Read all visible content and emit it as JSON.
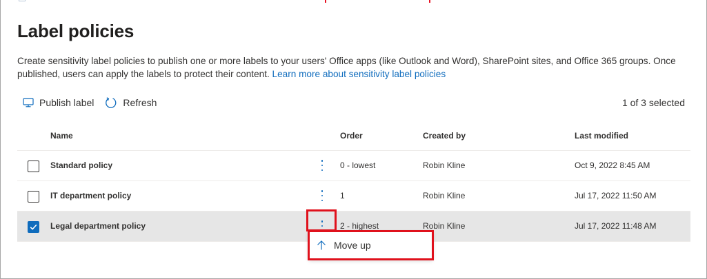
{
  "page": {
    "title": "Label policies",
    "description": "Create sensitivity label policies to publish one or more labels to your users' Office apps (like Outlook and Word), SharePoint sites, and Office 365 groups. Once published, users can apply the labels to protect their content.",
    "learn_more_link": "Learn more about sensitivity label policies"
  },
  "toolbar": {
    "publish_label": "Publish label",
    "publish_icon": "monitor-icon",
    "refresh_label": "Refresh",
    "refresh_icon": "refresh-icon",
    "selection_count": "1 of 3 selected"
  },
  "table": {
    "columns": {
      "name": "Name",
      "order": "Order",
      "created_by": "Created by",
      "last_modified": "Last modified"
    },
    "rows": [
      {
        "name": "Standard policy",
        "order": "0 - lowest",
        "created_by": "Robin Kline",
        "last_modified": "Oct 9, 2022 8:45 AM",
        "selected": false
      },
      {
        "name": "IT department policy",
        "order": "1",
        "created_by": "Robin Kline",
        "last_modified": "Jul 17, 2022 11:50 AM",
        "selected": false
      },
      {
        "name": "Legal department policy",
        "order": "2 - highest",
        "created_by": "Robin Kline",
        "last_modified": "Jul 17, 2022 11:48 AM",
        "selected": true
      }
    ]
  },
  "context_menu": {
    "move_up_label": "Move up",
    "move_up_icon": "arrow-up-icon"
  },
  "colors": {
    "accent": "#0f6cbd",
    "highlight": "#e0111c",
    "selected_row": "#e6e6e6"
  }
}
